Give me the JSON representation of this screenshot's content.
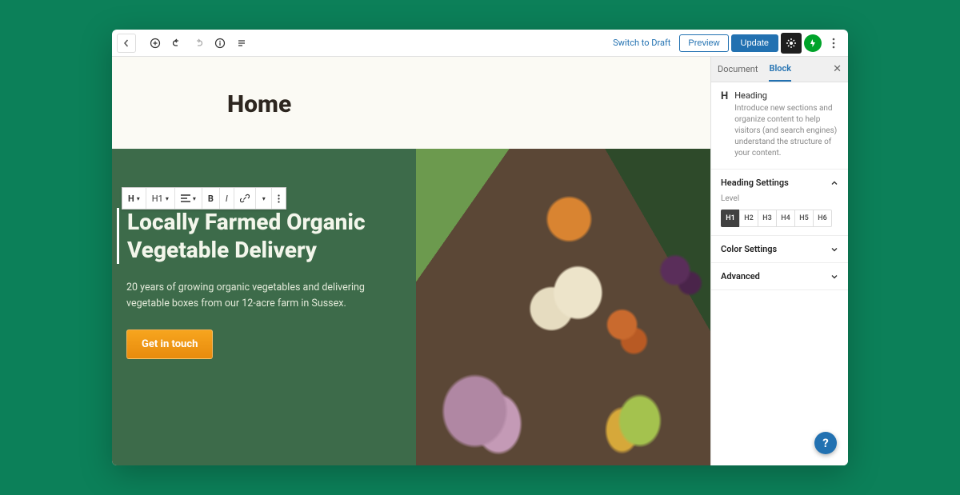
{
  "topbar": {
    "switch_draft": "Switch to Draft",
    "preview": "Preview",
    "update": "Update"
  },
  "page": {
    "title": "Home",
    "hero_heading": "Locally Farmed Organic Vegetable Delivery",
    "hero_sub": "20 years of growing organic vegetables and delivering vegetable boxes from our 12-acre farm in Sussex.",
    "cta": "Get in touch"
  },
  "block_toolbar": {
    "type_label": "H",
    "level_label": "H1",
    "align": "≡",
    "bold": "B",
    "italic": "I"
  },
  "sidebar": {
    "tabs": {
      "document": "Document",
      "block": "Block"
    },
    "block": {
      "name": "Heading",
      "desc": "Introduce new sections and organize content to help visitors (and search engines) understand the structure of your content."
    },
    "sections": {
      "heading_settings": "Heading Settings",
      "level_label": "Level",
      "levels": [
        "H1",
        "H2",
        "H3",
        "H4",
        "H5",
        "H6"
      ],
      "color_settings": "Color Settings",
      "advanced": "Advanced"
    }
  }
}
